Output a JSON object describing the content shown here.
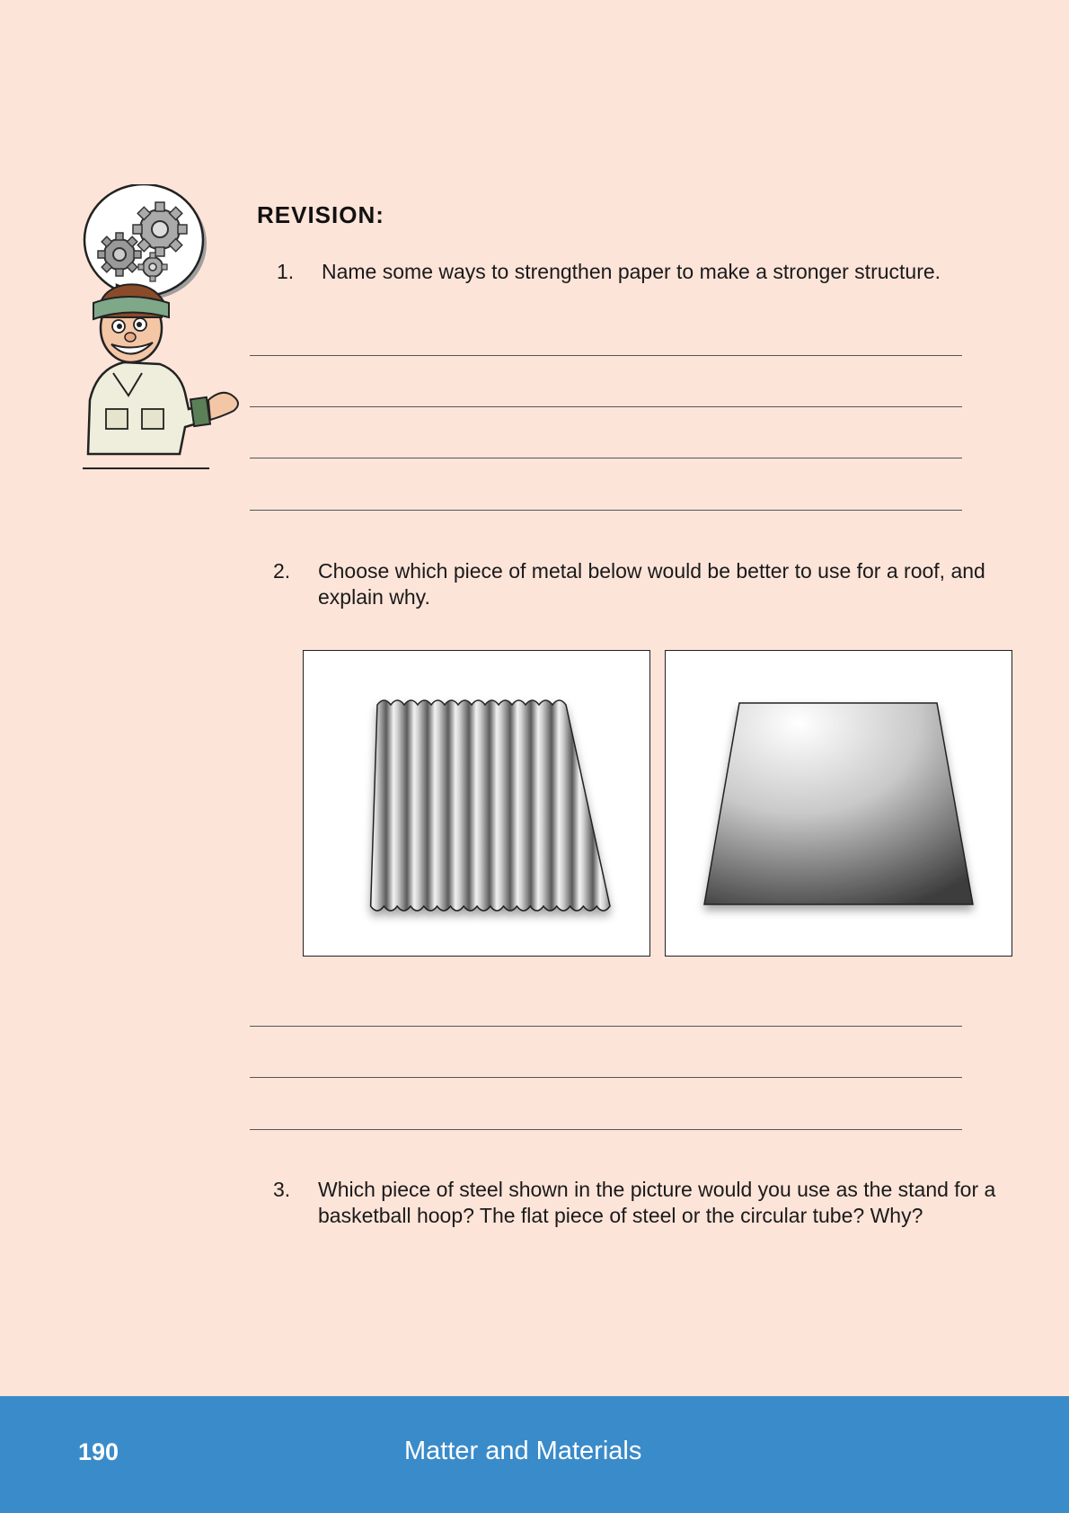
{
  "revision": {
    "heading": "REVISION:"
  },
  "questions": [
    {
      "number": "1.",
      "text": "Name some ways to strengthen paper to make a stronger structure."
    },
    {
      "number": "2.",
      "text": "Choose which piece of metal below would be better to use for a roof, and explain why."
    },
    {
      "number": "3.",
      "text": "Which piece of steel shown in the picture would you use as the stand for a basketball hoop? The flat piece of steel or the circular tube? Why?"
    }
  ],
  "footer": {
    "page_number": "190",
    "title": "Matter and Materials"
  },
  "colors": {
    "page_background": "#fde4d9",
    "footer_background": "#3a8bc9"
  },
  "icons": [
    "gears-icon",
    "mascot-character",
    "corrugated-metal-sheet",
    "flat-metal-sheet"
  ]
}
